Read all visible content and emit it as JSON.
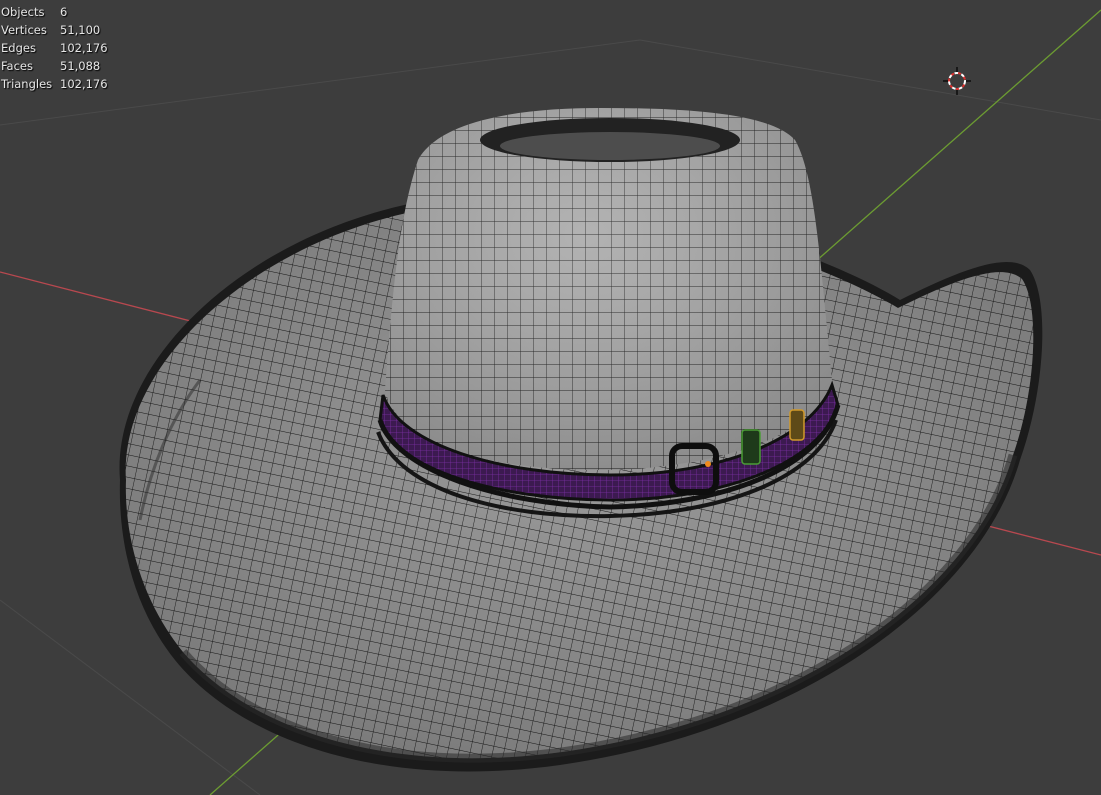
{
  "viewport": {
    "background": "#3d3d3d",
    "axis_x_color": "#b8484f",
    "axis_y_color": "#6c9c32"
  },
  "statistics": [
    {
      "label": "Objects",
      "value": "6"
    },
    {
      "label": "Vertices",
      "value": "51,100"
    },
    {
      "label": "Edges",
      "value": "102,176"
    },
    {
      "label": "Faces",
      "value": "51,088"
    },
    {
      "label": "Triangles",
      "value": "102,176"
    }
  ],
  "model": {
    "mesh_color": "#a9a9a9",
    "wire_color": "#111111",
    "band_color": "#5a2a72",
    "band_accent": "#a23bd0"
  },
  "icons": {
    "cursor": "3d-cursor-icon"
  }
}
